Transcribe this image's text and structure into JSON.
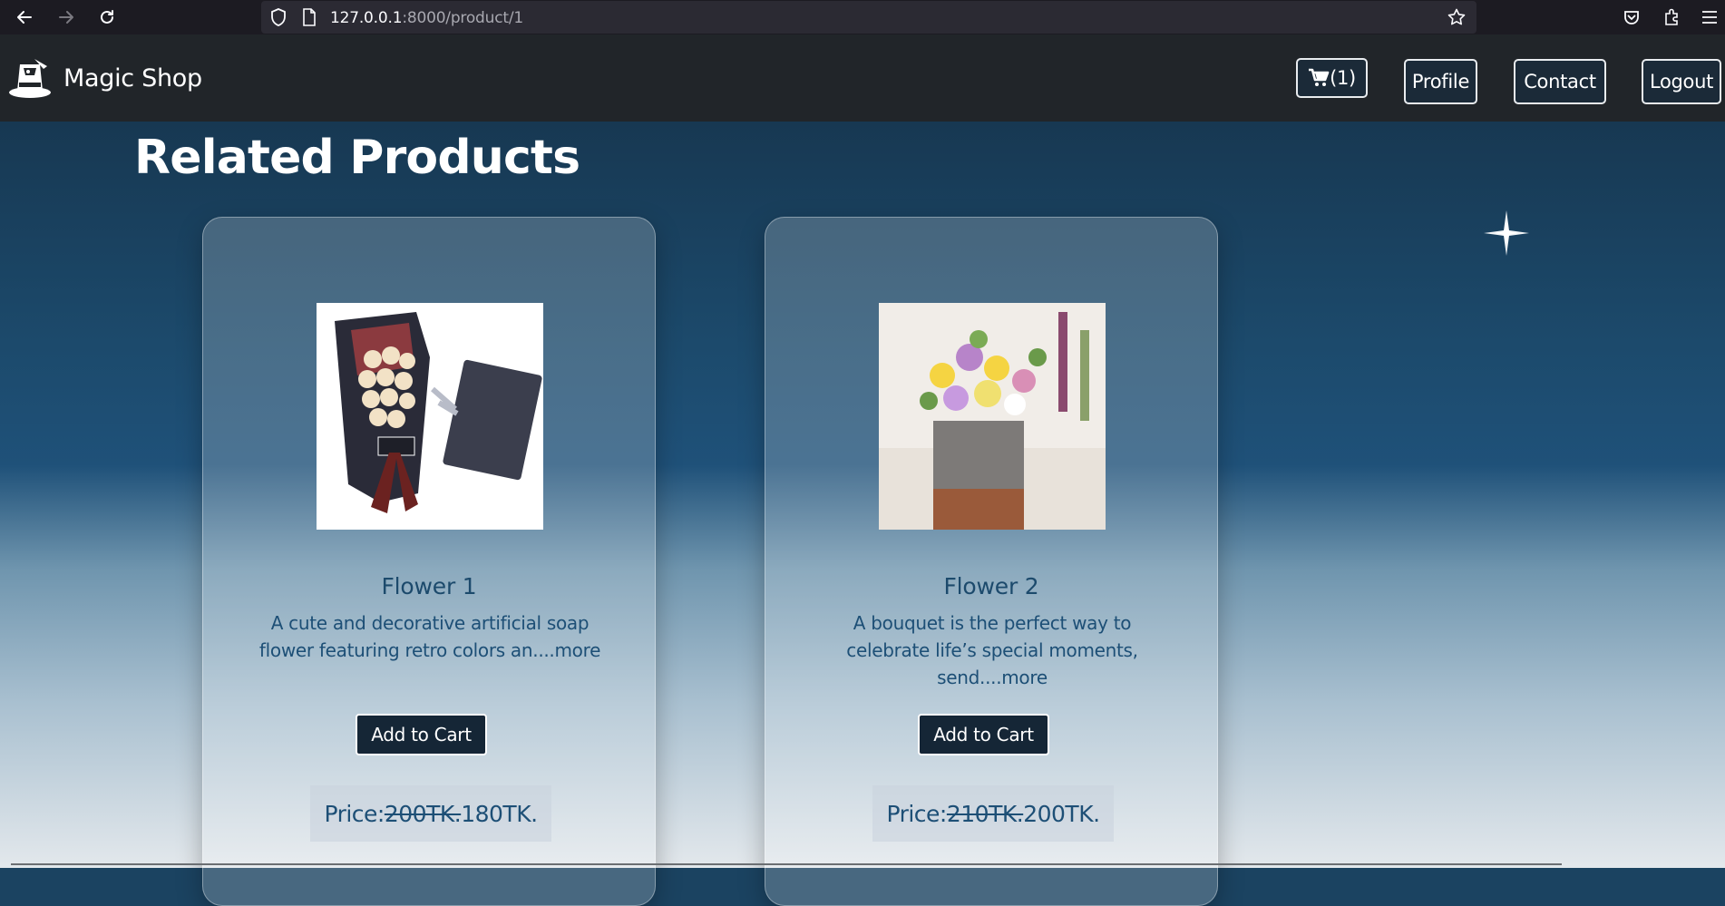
{
  "browser": {
    "url_host": "127.0.0.1",
    "url_path": ":8000/product/1"
  },
  "navbar": {
    "brand_name": "Magic Shop",
    "cart_count": "(1)",
    "profile_label": "Profile",
    "contact_label": "Contact",
    "logout_label": "Logout"
  },
  "section": {
    "title": "Related Products"
  },
  "products": [
    {
      "name": "Flower 1",
      "description": "A cute and decorative artificial soap flower featuring retro colors an....more",
      "button_label": "Add to Cart",
      "price_label": "Price:",
      "old_price": "200TK.",
      "new_price": "180TK."
    },
    {
      "name": "Flower 2",
      "description": "A bouquet is the perfect way to celebrate life’s special moments, send....more",
      "button_label": "Add to Cart",
      "price_label": "Price:",
      "old_price": "210TK.",
      "new_price": "200TK."
    }
  ],
  "colors": {
    "navbar_bg": "#212529",
    "title_color": "#1c4a6c",
    "button_bg": "#152636"
  }
}
